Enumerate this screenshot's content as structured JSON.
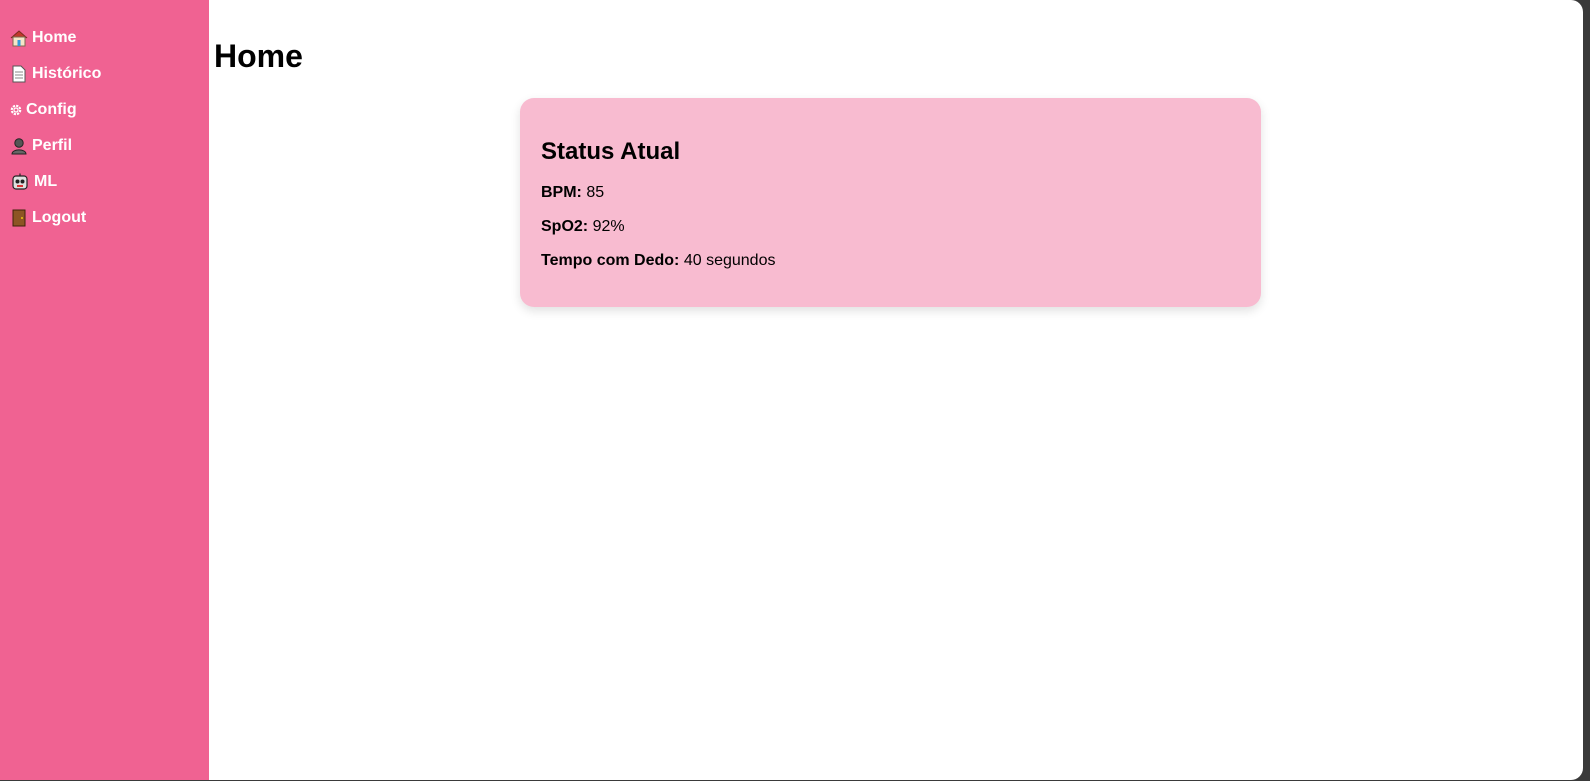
{
  "sidebar": {
    "items": [
      {
        "icon": "house-icon",
        "label": "Home"
      },
      {
        "icon": "document-icon",
        "label": "Histórico"
      },
      {
        "icon": "gear-icon",
        "label": "Config"
      },
      {
        "icon": "person-icon",
        "label": "Perfil"
      },
      {
        "icon": "robot-icon",
        "label": "ML"
      },
      {
        "icon": "door-icon",
        "label": "Logout"
      }
    ]
  },
  "main": {
    "title": "Home",
    "status_card": {
      "title": "Status Atual",
      "bpm_label": "BPM:",
      "bpm_value": "85",
      "spo2_label": "SpO2:",
      "spo2_value": "92%",
      "finger_time_label": "Tempo com Dedo:",
      "finger_time_value": "40 segundos"
    }
  },
  "colors": {
    "sidebar_bg": "#f06292",
    "card_bg": "#f8bbd0"
  }
}
